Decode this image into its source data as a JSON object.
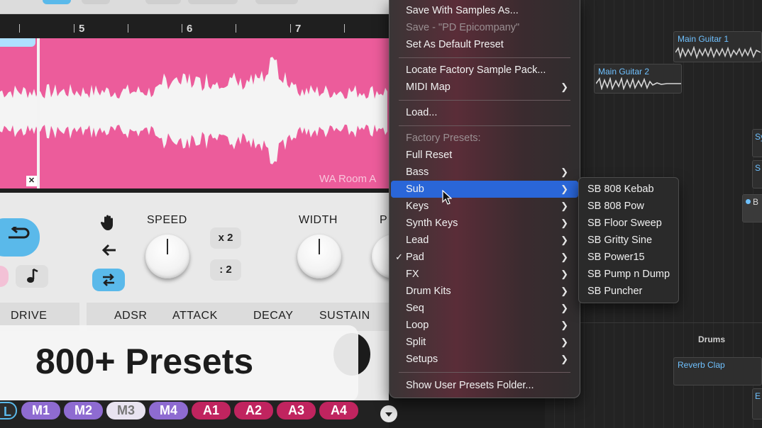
{
  "plugin": {
    "ruler_numbers": [
      "5",
      "6",
      "7"
    ],
    "waveform_label": "WA Room A",
    "clear_symbol": "✕",
    "knob_labels": {
      "speed": "SPEED",
      "width": "WIDTH",
      "partial": "P"
    },
    "speed_multipliers": [
      "x 2",
      ": 2"
    ],
    "section_labels": [
      "DRIVE",
      "ADSR",
      "ATTACK",
      "DECAY",
      "SUSTAIN"
    ],
    "icons": [
      "loop-arrow-icon",
      "music-note-icon",
      "hand-icon",
      "arrow-left-icon",
      "swap-arrows-icon",
      "chevron-down-icon"
    ],
    "macros": [
      "L",
      "M1",
      "M2",
      "M3",
      "M4",
      "A1",
      "A2",
      "A3",
      "A4"
    ],
    "overlay_title": "800+ Presets",
    "colors": {
      "waveform_bg": "#ec5c9b",
      "accent_blue": "#5ab9ea",
      "macro_purple": "#8e6bd1",
      "macro_red": "#c0245f"
    }
  },
  "menu": {
    "items": [
      {
        "label": "Save With Samples As...",
        "disabled": false
      },
      {
        "label": "Save - \"PD Epicompany\"",
        "disabled": true
      },
      {
        "label": "Set As Default Preset",
        "disabled": false
      },
      {
        "label": "Locate Factory Sample Pack...",
        "disabled": false
      },
      {
        "label": "MIDI Map",
        "submenu": true
      },
      {
        "label": "Load...",
        "disabled": false
      },
      {
        "label": "Factory Presets:",
        "disabled": true
      },
      {
        "label": "Full Reset"
      },
      {
        "label": "Bass",
        "submenu": true
      },
      {
        "label": "Sub",
        "submenu": true,
        "highlighted": true
      },
      {
        "label": "Keys",
        "submenu": true
      },
      {
        "label": "Synth Keys",
        "submenu": true
      },
      {
        "label": "Lead",
        "submenu": true
      },
      {
        "label": "Pad",
        "submenu": true,
        "checked": true
      },
      {
        "label": "FX",
        "submenu": true
      },
      {
        "label": "Drum Kits",
        "submenu": true
      },
      {
        "label": "Seq",
        "submenu": true
      },
      {
        "label": "Loop",
        "submenu": true
      },
      {
        "label": "Split",
        "submenu": true
      },
      {
        "label": "Setups",
        "submenu": true
      },
      {
        "label": "Show User Presets Folder..."
      }
    ],
    "submenu_arrow": "❯",
    "check_mark": "✓",
    "sub_presets": [
      "SB 808 Kebab",
      "SB 808 Pow",
      "SB Floor Sweep",
      "SB Gritty Sine",
      "SB Power15",
      "SB Pump n Dump",
      "SB Puncher"
    ]
  },
  "daw": {
    "clips": [
      "Main Guitar 1",
      "Main Guitar 2",
      "Reverb Clap"
    ],
    "partial_clips": [
      "Sy",
      "S",
      "B",
      "E"
    ],
    "track_label": "Drums",
    "colors": {
      "clip_name": "#6fc1ff"
    }
  }
}
